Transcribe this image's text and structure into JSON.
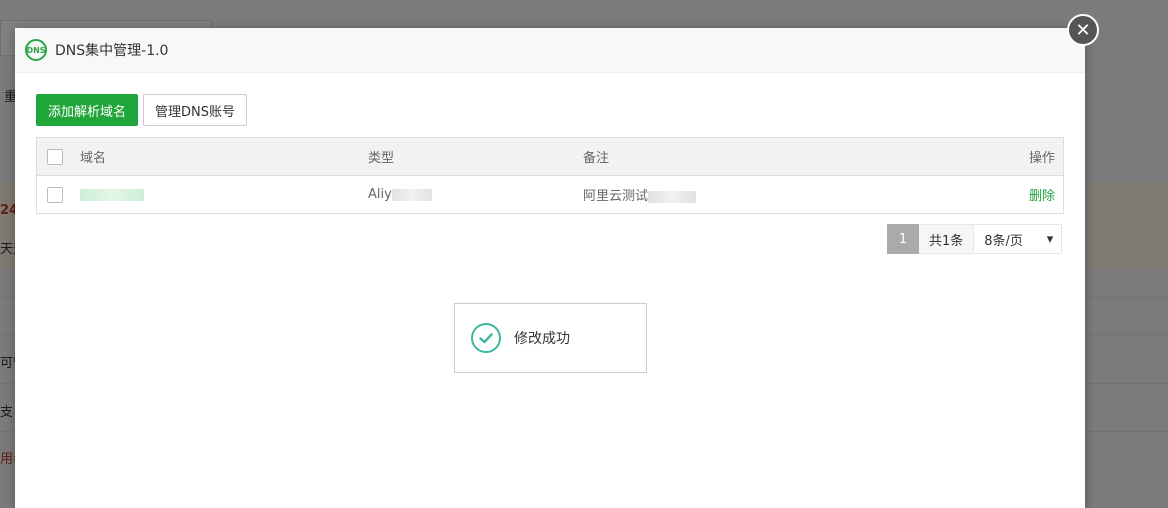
{
  "background": {
    "fragments": [
      "重",
      "24",
      "天天",
      "可管",
      "支",
      "用者"
    ]
  },
  "modal": {
    "logo_text": "DNS",
    "title": "DNS集中管理-1.0",
    "close_symbol": "✕"
  },
  "toolbar": {
    "add_label": "添加解析域名",
    "manage_label": "管理DNS账号"
  },
  "table": {
    "headers": {
      "domain": "域名",
      "type": "类型",
      "note": "备注",
      "action": "操作"
    },
    "rows": [
      {
        "domain": "",
        "type": "Aliy",
        "note": "阿里云测试",
        "action": "删除"
      }
    ]
  },
  "pager": {
    "current": "1",
    "total": "共1条",
    "per_page": "8条/页",
    "caret": "▾"
  },
  "toast": {
    "message": "修改成功",
    "icon": "check-circle-icon"
  },
  "colors": {
    "accent": "#20a53a",
    "toast_icon": "#3eb6a0"
  }
}
